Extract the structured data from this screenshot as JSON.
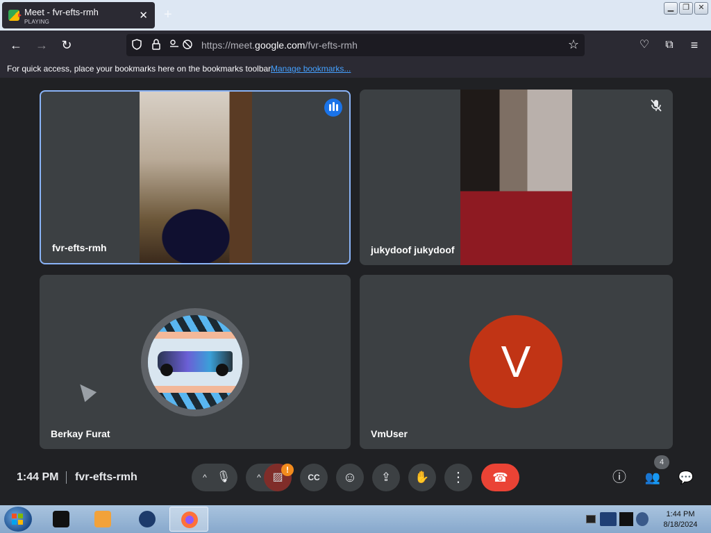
{
  "tab": {
    "title": "Meet - fvr-efts-rmh",
    "subtitle": "PLAYING",
    "close": "✕",
    "new_tab": "+"
  },
  "window_buttons": [
    "▁",
    "❐",
    "✕"
  ],
  "nav": {
    "back": "←",
    "forward": "→",
    "reload": "↻"
  },
  "urlbar": {
    "prefix": "https://meet.",
    "host": "google.com",
    "path": "/fvr-efts-rmh",
    "bookmark_star": "☆"
  },
  "toolbar_icons": {
    "pocket": "♡",
    "extensions": "⧉",
    "menu": "≡"
  },
  "bookmarks_bar": {
    "message": "For quick access, place your bookmarks here on the bookmarks toolbar.",
    "link": "Manage bookmarks..."
  },
  "participants": [
    {
      "name": "fvr-efts-rmh",
      "speaking": true
    },
    {
      "name": "jukydoof jukydoof",
      "muted": true
    },
    {
      "name": "Berkay Furat"
    },
    {
      "name": "VmUser",
      "avatar_letter": "V",
      "avatar_color": "#c13415"
    }
  ],
  "meeting": {
    "time": "1:44 PM",
    "code": "fvr-efts-rmh"
  },
  "controls": {
    "caret": "^",
    "mic": "🎙",
    "camera_off": "▨",
    "camera_warning": "!",
    "captions": "CC",
    "emoji": "☺",
    "present": "⇪",
    "raise_hand": "✋",
    "more": "⋮",
    "end_call": "☎"
  },
  "right_controls": {
    "info": "ⓘ",
    "people": "👥",
    "chat": "💬",
    "people_count": "4"
  },
  "taskbar": {
    "time": "1:44 PM",
    "date": "8/18/2024"
  },
  "colors": {
    "accent": "#8ab4f8",
    "end_call": "#ea4335",
    "speaking": "#1a73e8",
    "tile_bg": "#3c4043",
    "meet_bg": "#202124"
  }
}
